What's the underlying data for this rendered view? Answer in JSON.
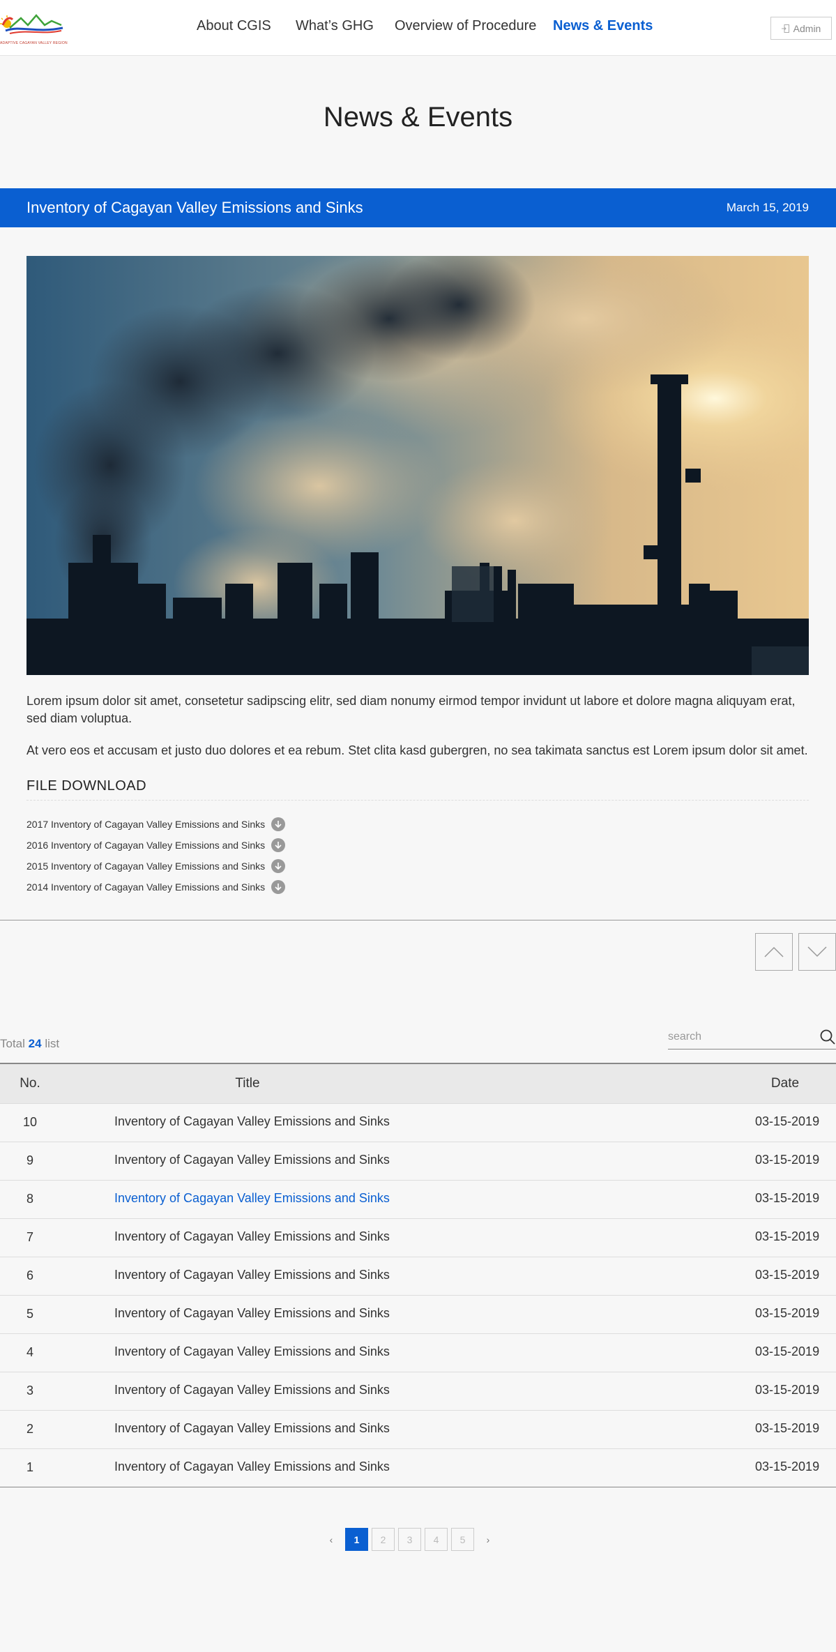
{
  "header": {
    "logo_text": "ADAPTIVE CAGAYAN VALLEY REGION",
    "nav": [
      {
        "label": "About CGIS"
      },
      {
        "label": "What’s GHG"
      },
      {
        "label": "Overview of Procedure"
      },
      {
        "label": "News & Events"
      }
    ],
    "admin_label": "Admin"
  },
  "page_title": "News & Events",
  "article": {
    "title": "Inventory of Cagayan Valley Emissions and Sinks",
    "date": "March 15, 2019",
    "paragraph1": "Lorem ipsum dolor sit amet, consetetur sadipscing elitr,  sed diam nonumy eirmod tempor invidunt ut labore et dolore magna aliquyam erat, sed diam voluptua.",
    "paragraph2": "At vero eos et accusam et justo duo dolores et ea rebum. Stet clita kasd gubergren, no sea takimata sanctus est Lorem ipsum dolor sit amet.",
    "file_download_title": "FILE DOWNLOAD",
    "files": [
      {
        "name": "2017 Inventory of Cagayan Valley Emissions and Sinks"
      },
      {
        "name": "2016 Inventory of Cagayan Valley Emissions and Sinks"
      },
      {
        "name": "2015 Inventory of Cagayan Valley Emissions and Sinks"
      },
      {
        "name": "2014 Inventory of Cagayan Valley Emissions and Sinks"
      }
    ]
  },
  "list": {
    "total_prefix": "Total",
    "total_count": "24",
    "total_suffix": "list",
    "search_placeholder": "search",
    "headers": {
      "no": "No.",
      "title": "Title",
      "date": "Date"
    },
    "rows": [
      {
        "no": "10",
        "title": "Inventory of Cagayan Valley Emissions and Sinks",
        "date": "03-15-2019"
      },
      {
        "no": "9",
        "title": "Inventory of Cagayan Valley Emissions and Sinks",
        "date": "03-15-2019"
      },
      {
        "no": "8",
        "title": "Inventory of Cagayan Valley Emissions and Sinks",
        "date": "03-15-2019"
      },
      {
        "no": "7",
        "title": "Inventory of Cagayan Valley Emissions and Sinks",
        "date": "03-15-2019"
      },
      {
        "no": "6",
        "title": "Inventory of Cagayan Valley Emissions and Sinks",
        "date": "03-15-2019"
      },
      {
        "no": "5",
        "title": "Inventory of Cagayan Valley Emissions and Sinks",
        "date": "03-15-2019"
      },
      {
        "no": "4",
        "title": "Inventory of Cagayan Valley Emissions and Sinks",
        "date": "03-15-2019"
      },
      {
        "no": "3",
        "title": "Inventory of Cagayan Valley Emissions and Sinks",
        "date": "03-15-2019"
      },
      {
        "no": "2",
        "title": "Inventory of Cagayan Valley Emissions and Sinks",
        "date": "03-15-2019"
      },
      {
        "no": "1",
        "title": "Inventory of Cagayan Valley Emissions and Sinks",
        "date": "03-15-2019"
      }
    ]
  },
  "pagination": {
    "prev": "‹",
    "next": "›",
    "pages": [
      "1",
      "2",
      "3",
      "4",
      "5"
    ],
    "current": "1"
  },
  "colors": {
    "accent": "#0a5fd1",
    "background": "#f7f7f7"
  },
  "icons": [
    "logo-icon",
    "login-icon",
    "download-icon",
    "chevron-up-icon",
    "chevron-down-icon",
    "search-icon"
  ]
}
